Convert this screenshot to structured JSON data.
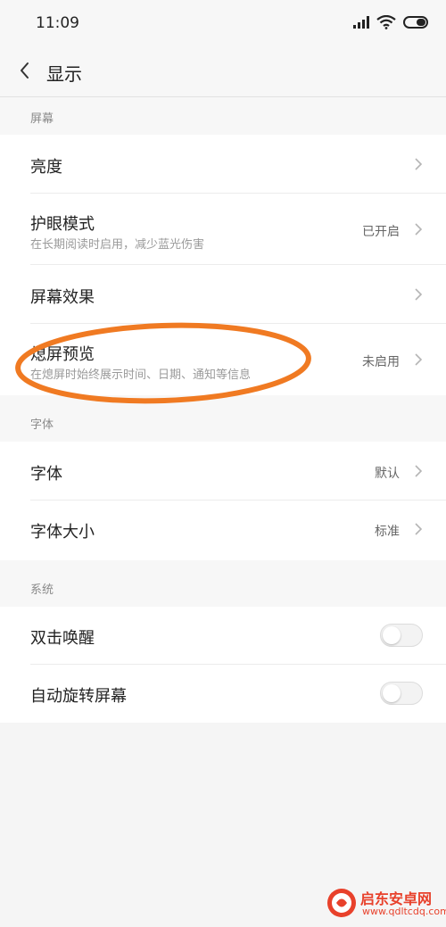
{
  "status_bar": {
    "time": "11:09"
  },
  "nav": {
    "title": "显示"
  },
  "sections": {
    "screen": {
      "label": "屏幕",
      "items": [
        {
          "title": "亮度"
        },
        {
          "title": "护眼模式",
          "subtitle": "在长期阅读时启用，减少蓝光伤害",
          "value": "已开启"
        },
        {
          "title": "屏幕效果"
        },
        {
          "title": "熄屏预览",
          "subtitle": "在熄屏时始终展示时间、日期、通知等信息",
          "value": "未启用"
        }
      ]
    },
    "font": {
      "label": "字体",
      "items": [
        {
          "title": "字体",
          "value": "默认"
        },
        {
          "title": "字体大小",
          "value": "标准"
        }
      ]
    },
    "system": {
      "label": "系统",
      "items": [
        {
          "title": "双击唤醒",
          "toggle_on": false
        },
        {
          "title": "自动旋转屏幕",
          "toggle_on": false
        }
      ]
    }
  },
  "annotation_color": "#f07a22",
  "watermark": {
    "name": "启东安卓网",
    "url": "www.qdltcdq.com"
  }
}
